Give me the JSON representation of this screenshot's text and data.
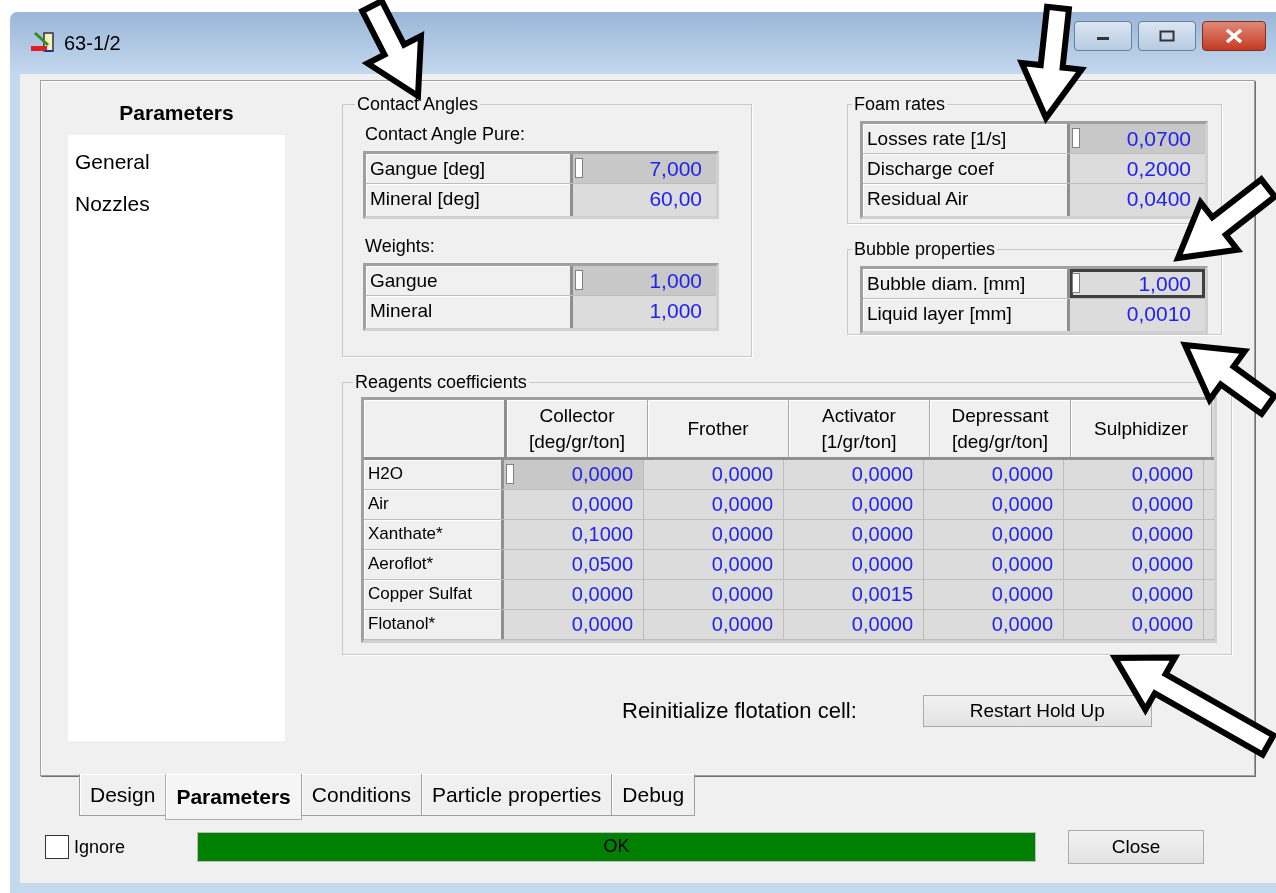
{
  "window": {
    "title": "63-1/2"
  },
  "sidebar": {
    "title": "Parameters",
    "items": [
      {
        "label": "General"
      },
      {
        "label": "Nozzles"
      }
    ]
  },
  "contact_angles": {
    "title": "Contact Angles",
    "groups": [
      {
        "label": "Contact Angle Pure:",
        "rows": [
          {
            "name": "Gangue [deg]",
            "value": "7,000",
            "selected": true
          },
          {
            "name": "Mineral [deg]",
            "value": "60,00",
            "selected": false
          }
        ]
      },
      {
        "label": "Weights:",
        "rows": [
          {
            "name": "Gangue",
            "value": "1,000",
            "selected": true
          },
          {
            "name": "Mineral",
            "value": "1,000",
            "selected": false
          }
        ]
      }
    ]
  },
  "foam_rates": {
    "title": "Foam rates",
    "rows": [
      {
        "name": "Losses rate [1/s]",
        "value": "0,0700",
        "selected": true
      },
      {
        "name": "Discharge coef",
        "value": "0,2000",
        "selected": false
      },
      {
        "name": "Residual Air",
        "value": "0,0400",
        "selected": false
      }
    ]
  },
  "bubble_properties": {
    "title": "Bubble properties",
    "focused": true,
    "rows": [
      {
        "name": "Bubble diam. [mm]",
        "value": "1,000",
        "selected": true
      },
      {
        "name": "Liquid layer [mm]",
        "value": "0,0010",
        "selected": false
      }
    ]
  },
  "reagents": {
    "title": "Reagents coefficients",
    "columns": [
      {
        "lines": [
          "Collector",
          "[deg/gr/ton]"
        ]
      },
      {
        "lines": [
          "Frother"
        ]
      },
      {
        "lines": [
          "Activator",
          "[1/gr/ton]"
        ]
      },
      {
        "lines": [
          "Depressant",
          "[deg/gr/ton]"
        ]
      },
      {
        "lines": [
          "Sulphidizer"
        ]
      }
    ],
    "rows": [
      {
        "name": "H2O",
        "selected": true,
        "values": [
          "0,0000",
          "0,0000",
          "0,0000",
          "0,0000",
          "0,0000"
        ]
      },
      {
        "name": "Air",
        "selected": false,
        "values": [
          "0,0000",
          "0,0000",
          "0,0000",
          "0,0000",
          "0,0000"
        ]
      },
      {
        "name": "Xanthate*",
        "selected": false,
        "values": [
          "0,1000",
          "0,0000",
          "0,0000",
          "0,0000",
          "0,0000"
        ]
      },
      {
        "name": "Aeroflot*",
        "selected": false,
        "values": [
          "0,0500",
          "0,0000",
          "0,0000",
          "0,0000",
          "0,0000"
        ]
      },
      {
        "name": "Copper Sulfat",
        "selected": false,
        "values": [
          "0,0000",
          "0,0000",
          "0,0015",
          "0,0000",
          "0,0000"
        ]
      },
      {
        "name": "Flotanol*",
        "selected": false,
        "values": [
          "0,0000",
          "0,0000",
          "0,0000",
          "0,0000",
          "0,0000"
        ]
      }
    ]
  },
  "reinitialize": {
    "label": "Reinitialize flotation cell:",
    "button": "Restart Hold Up"
  },
  "tabs": [
    {
      "label": "Design",
      "selected": false
    },
    {
      "label": "Parameters",
      "selected": true
    },
    {
      "label": "Conditions",
      "selected": false
    },
    {
      "label": "Particle properties",
      "selected": false
    },
    {
      "label": "Debug",
      "selected": false
    }
  ],
  "ignore": {
    "label": "Ignore",
    "checked": false
  },
  "status": {
    "text": "OK",
    "level": 1
  },
  "close_button": "Close"
}
